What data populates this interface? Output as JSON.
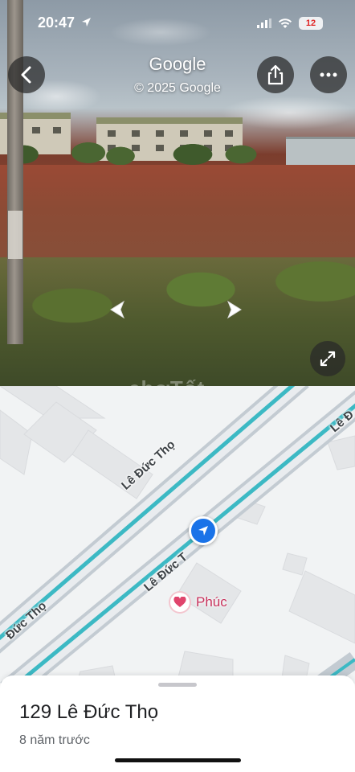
{
  "status_bar": {
    "time": "20:47",
    "location_icon": "location-arrow-icon",
    "battery_level": "12",
    "battery_color": "#e02424"
  },
  "header": {
    "title": "Google",
    "copyright": "© 2025 Google",
    "back_icon": "chevron-left-icon",
    "share_icon": "share-icon",
    "more_icon": "more-horizontal-icon"
  },
  "street_view": {
    "prev_icon": "chevron-left-icon",
    "next_icon": "chevron-right-icon",
    "expand_icon": "expand-icon",
    "watermark": "chợTốt"
  },
  "map": {
    "road_labels": [
      "Lê Đức Thọ",
      "Lê Đức T",
      "Đức Thọ",
      "Lê Đ"
    ],
    "poi_name": "Phúc",
    "road_color": "#3cb9c4"
  },
  "place": {
    "address": "129 Lê Đức Thọ",
    "age": "8 năm trước"
  }
}
